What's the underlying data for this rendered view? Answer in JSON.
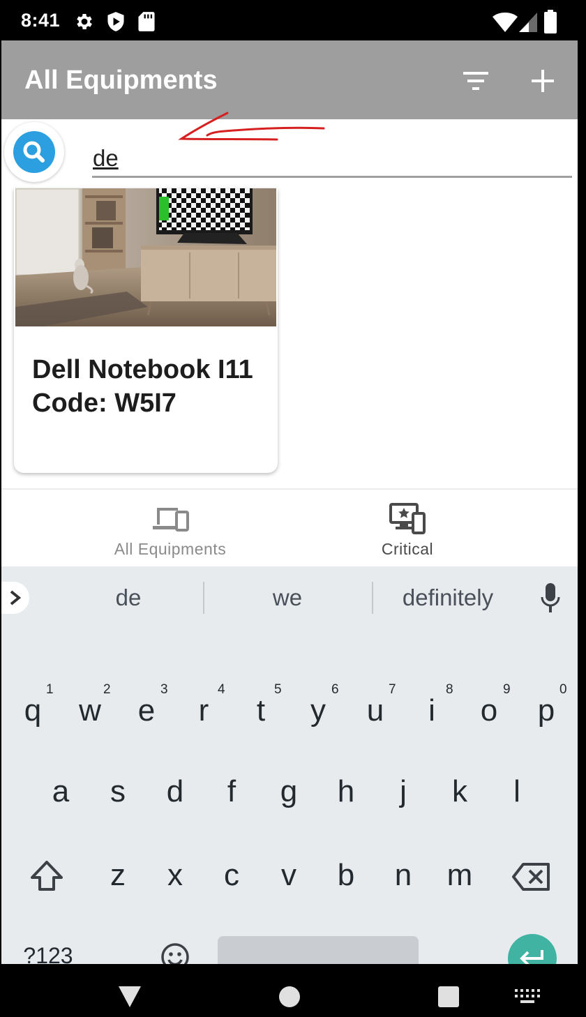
{
  "status_bar": {
    "time": "8:41",
    "left_icons": [
      "gear-icon",
      "shield-play-icon",
      "sd-card-icon"
    ],
    "right_icons": [
      "wifi-icon",
      "cell-signal-icon",
      "battery-icon"
    ]
  },
  "app_bar": {
    "title": "All Equipments",
    "actions": [
      "filter-icon",
      "add-icon"
    ],
    "background": "#9e9e9e"
  },
  "search": {
    "value": "de",
    "icon": "search-icon",
    "accent": "#2b9fe0"
  },
  "equipment_list": [
    {
      "name": "Dell Notebook I11",
      "code_label": "Code: W5I7",
      "image": "living-room-tv-cat-photo"
    }
  ],
  "bottom_nav": {
    "items": [
      {
        "label": "All Equipments",
        "icon": "devices-icon",
        "active": false
      },
      {
        "label": "Critical",
        "icon": "devices-star-icon",
        "active": true
      }
    ]
  },
  "keyboard": {
    "suggestions": [
      "de",
      "we",
      "definitely"
    ],
    "row1": [
      "q",
      "w",
      "e",
      "r",
      "t",
      "y",
      "u",
      "i",
      "o",
      "p"
    ],
    "row1_hints": [
      "1",
      "2",
      "3",
      "4",
      "5",
      "6",
      "7",
      "8",
      "9",
      "0"
    ],
    "row2": [
      "a",
      "s",
      "d",
      "f",
      "g",
      "h",
      "j",
      "k",
      "l"
    ],
    "row3": [
      "z",
      "x",
      "c",
      "v",
      "b",
      "n",
      "m"
    ],
    "symbols_label": "?123",
    "comma": ",",
    "period": ".",
    "enter_color": "#41b3a3"
  },
  "system_nav": [
    "back-icon",
    "home-icon",
    "recents-icon",
    "keyboard-switch-icon"
  ]
}
